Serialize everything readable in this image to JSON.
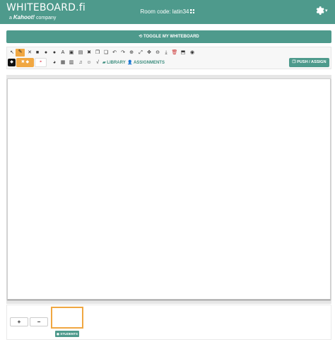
{
  "header": {
    "logo_text": "WHITEBOARD.fi",
    "logo_sub_prefix": "a",
    "logo_sub_brand": "Kahoot!",
    "logo_sub_suffix": "company",
    "room_label": "Room code: latin34",
    "settings_caret": "▾"
  },
  "toggle": {
    "label": "TOGGLE MY WHITEBOARD"
  },
  "toolbar": {
    "library_label": "LIBRARY",
    "assignments_label": "ASSIGNMENTS",
    "push_label": "PUSH / ASSIGN",
    "text_tool_label": "A"
  },
  "pager": {
    "add_label": "+",
    "remove_label": "−"
  },
  "students_label": "STUDENTS",
  "colors": {
    "brand": "#4e9a8c",
    "accent": "#f0a742"
  }
}
